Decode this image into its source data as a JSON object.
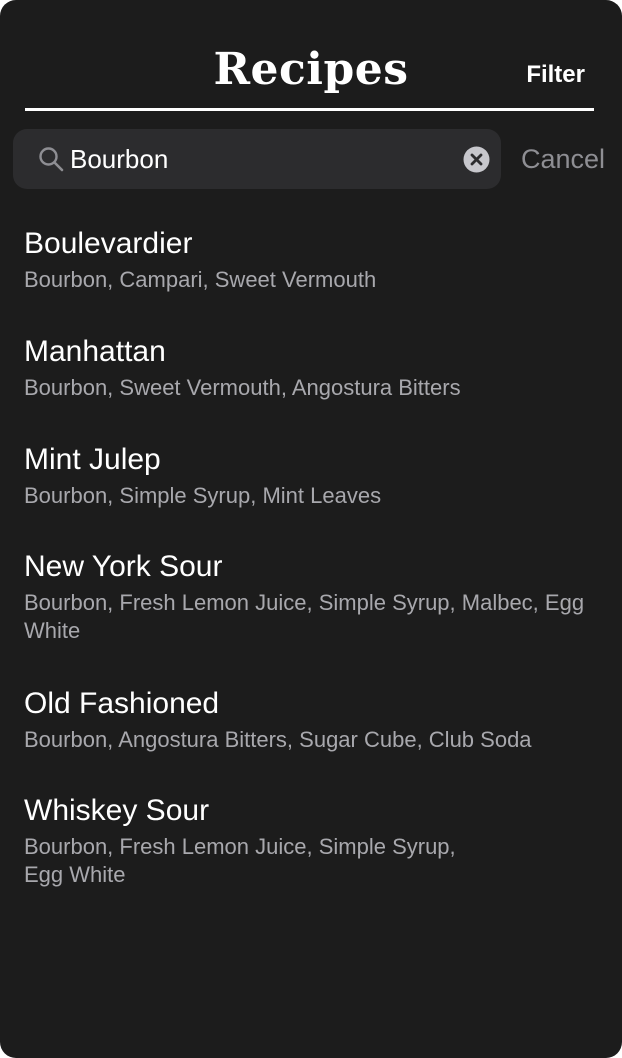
{
  "header": {
    "title": "Recipes",
    "filter_label": "Filter"
  },
  "search": {
    "value": "Bourbon",
    "cancel_label": "Cancel"
  },
  "recipes": [
    {
      "name": "Boulevardier",
      "ingredients": "Bourbon, Campari, Sweet Vermouth"
    },
    {
      "name": "Manhattan",
      "ingredients": "Bourbon, Sweet Vermouth, Angostura Bitters"
    },
    {
      "name": "Mint Julep",
      "ingredients": "Bourbon, Simple Syrup, Mint Leaves"
    },
    {
      "name": "New York Sour",
      "ingredients": "Bourbon, Fresh Lemon Juice, Simple Syrup, Malbec, Egg White"
    },
    {
      "name": "Old Fashioned",
      "ingredients": "Bourbon, Angostura Bitters, Sugar Cube, Club Soda"
    },
    {
      "name": "Whiskey Sour",
      "ingredients": "Bourbon, Fresh Lemon Juice, Simple Syrup,\nEgg White"
    }
  ],
  "icons": {
    "search": "search-icon",
    "clear": "clear-icon"
  },
  "colors": {
    "background": "#1c1c1c",
    "search_field": "#2c2c2e",
    "secondary_text": "#a8a8ad",
    "cancel_text": "#8e8e93"
  }
}
